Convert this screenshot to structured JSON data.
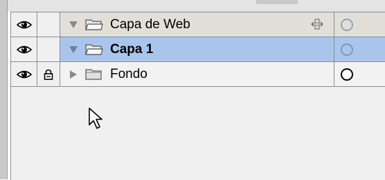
{
  "layers": [
    {
      "name": "Capa de Web",
      "visible": true,
      "locked": false,
      "expanded": true,
      "selected": false,
      "shows_options_icon": true,
      "eye_icon": "eye-icon",
      "folder_icon": "open-folder-icon"
    },
    {
      "name": "Capa 1",
      "visible": true,
      "locked": false,
      "expanded": true,
      "selected": true,
      "shows_options_icon": false,
      "eye_icon": "eye-icon",
      "folder_icon": "open-folder-icon"
    },
    {
      "name": "Fondo",
      "visible": true,
      "locked": true,
      "expanded": false,
      "selected": false,
      "shows_options_icon": false,
      "eye_icon": "eye-icon",
      "folder_icon": "closed-folder-icon"
    }
  ],
  "colors": {
    "selected_row": "#a9c5ec",
    "web_layer_row": "#e2dfd9",
    "panel_bg": "#f0f0f0",
    "gridline": "#8c8c8c"
  }
}
